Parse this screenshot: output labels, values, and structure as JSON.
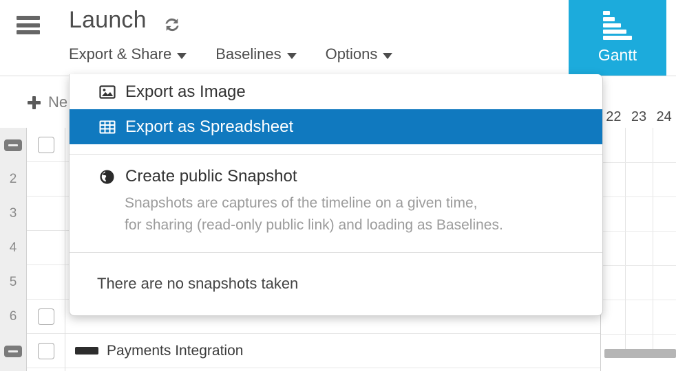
{
  "header": {
    "menu_icon": "hamburger-icon",
    "project_title": "Launch",
    "refresh_icon": "refresh-icon",
    "nav": [
      {
        "label": "Export & Share",
        "has_caret": true
      },
      {
        "label": "Baselines",
        "has_caret": true
      },
      {
        "label": "Options",
        "has_caret": true
      }
    ],
    "gantt_tab": {
      "label": "Gantt",
      "icon": "gantt-bars-icon",
      "color": "#1cabdc"
    }
  },
  "toolbar": {
    "new_label": "Ne",
    "plus_icon": "plus-icon"
  },
  "dropdown": {
    "items": [
      {
        "label": "Export as Image",
        "icon": "image-icon",
        "highlighted": false
      },
      {
        "label": "Export as Spreadsheet",
        "icon": "table-grid-icon",
        "highlighted": true
      }
    ],
    "snapshot": {
      "title": "Create public Snapshot",
      "icon": "globe-icon",
      "description_line1": "Snapshots are captures of the timeline on a given time,",
      "description_line2": "for sharing (read-only public link) and loading as Baselines."
    },
    "empty_state": "There are no snapshots taken",
    "highlight_color": "#1079bf"
  },
  "grid": {
    "rows": [
      {
        "number": "",
        "collapsed_toggle": true,
        "checkbox": true,
        "name": ""
      },
      {
        "number": "2",
        "collapsed_toggle": false,
        "checkbox": false,
        "name": ""
      },
      {
        "number": "3",
        "collapsed_toggle": false,
        "checkbox": false,
        "name": ""
      },
      {
        "number": "4",
        "collapsed_toggle": false,
        "checkbox": false,
        "name": ""
      },
      {
        "number": "5",
        "collapsed_toggle": false,
        "checkbox": false,
        "name": ""
      },
      {
        "number": "6",
        "collapsed_toggle": false,
        "checkbox": true,
        "name": ""
      },
      {
        "number": "",
        "collapsed_toggle": true,
        "checkbox": true,
        "name": "Payments Integration"
      }
    ]
  },
  "timeline": {
    "days": [
      "22",
      "23",
      "24"
    ]
  }
}
